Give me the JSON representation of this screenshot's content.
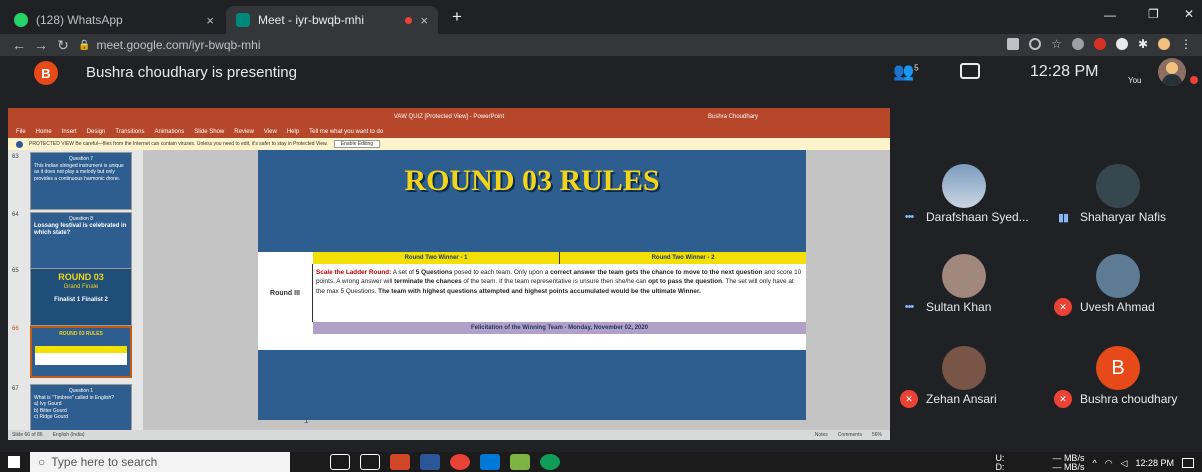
{
  "browser": {
    "tabs": [
      {
        "label": "(128) WhatsApp",
        "close": "×"
      },
      {
        "label": "Meet - iyr-bwqb-mhi",
        "close": "×"
      }
    ],
    "new_tab": "+",
    "window_min": "—",
    "window_restore": "❐",
    "window_close": "✕",
    "url": "meet.google.com/iyr-bwqb-mhi"
  },
  "meet": {
    "presenter_initial": "B",
    "presenting_text": "Bushra choudhary is presenting",
    "people_count": "5",
    "time": "12:28 PM",
    "you_label": "You"
  },
  "powerpoint": {
    "title": "VAW QUIZ [Protected View] - PowerPoint",
    "user": "Bushra Choudhary",
    "tell_me": "Tell me what you want to do",
    "menu": [
      "File",
      "Home",
      "Insert",
      "Design",
      "Transitions",
      "Animations",
      "Slide Show",
      "Review",
      "View",
      "Help"
    ],
    "warning": "PROTECTED VIEW  Be careful—files from the Internet can contain viruses. Unless you need to edit, it's safer to stay in Protected View.",
    "enable_editing": "Enable Editing",
    "thumbnails": [
      {
        "num": "63",
        "heading": "Question 7",
        "text": "This Indian stringed instrument is unique as it does not play a melody but only provides a continuous harmonic drone."
      },
      {
        "num": "64",
        "heading": "Question 8",
        "text": "Lossang festival is celebrated in which state?"
      },
      {
        "num": "65",
        "heading": "ROUND 03",
        "sub": "Grand Finale",
        "finalists": "Finalist 1    Finalist 2"
      },
      {
        "num": "66",
        "heading": "ROUND 03 RULES"
      },
      {
        "num": "67",
        "heading": "Question 1",
        "text": "What is \"Timbree\" called in English?",
        "options": [
          "a) Ivy Gourd",
          "b) Bitter Gourd",
          "c) Ridge Gourd"
        ]
      }
    ],
    "slide": {
      "title": "ROUND 03 RULES",
      "headers": [
        "Round Two Winner - 1",
        "Round Two Winner - 2"
      ],
      "round_label": "Round III",
      "rule_lead": "Scale the Ladder Round:",
      "rule_1": " A set of ",
      "rule_bold_1": "5 Questions",
      "rule_2": " posed to each team. Only upon a ",
      "rule_bold_2": "correct answer the team gets the chance to move to the next question",
      "rule_3": " and score 10 points. A wrong answer will ",
      "rule_bold_3": "terminate the chances",
      "rule_4": " of the team. If the team representative is unsure then she/he can ",
      "rule_bold_4": "opt to pass the question",
      "rule_5": ". The set will only have at the max 5 Questions. ",
      "rule_bold_5": "The team with highest questions attempted and highest points accumulated would be the ultimate Winner.",
      "footer": "Felicitation of the Winning Team - Monday, November 02, 2020"
    },
    "notes_number": "1",
    "status_left": "Slide 66 of 86",
    "status_lang": "English (India)",
    "status_notes": "Notes",
    "status_comments": "Comments",
    "zoom": "56%"
  },
  "participants": [
    {
      "name": "Darafshaan Syed...",
      "indicator": "dots"
    },
    {
      "name": "Shaharyar Nafis",
      "indicator": "speaking"
    },
    {
      "name": "Sultan Khan",
      "indicator": "dots"
    },
    {
      "name": "Uvesh Ahmad",
      "indicator": "mute"
    },
    {
      "name": "Zehan Ansari",
      "indicator": "mute"
    },
    {
      "name": "Bushra choudhary",
      "indicator": "mute",
      "initial": "B"
    }
  ],
  "taskbar": {
    "search_placeholder": "Type here to search",
    "net_up": "U:",
    "net_down": "D:",
    "net_rate": "— MB/s",
    "net_rate2": "— MB/s",
    "time": "12:28 PM"
  },
  "colors": {
    "powerpoint_red": "#b7472a",
    "slide_blue": "#2e5d8f",
    "slide_title_yellow": "#f2d41b",
    "mute_red": "#ea4335",
    "presenter_orange": "#e64a19"
  }
}
